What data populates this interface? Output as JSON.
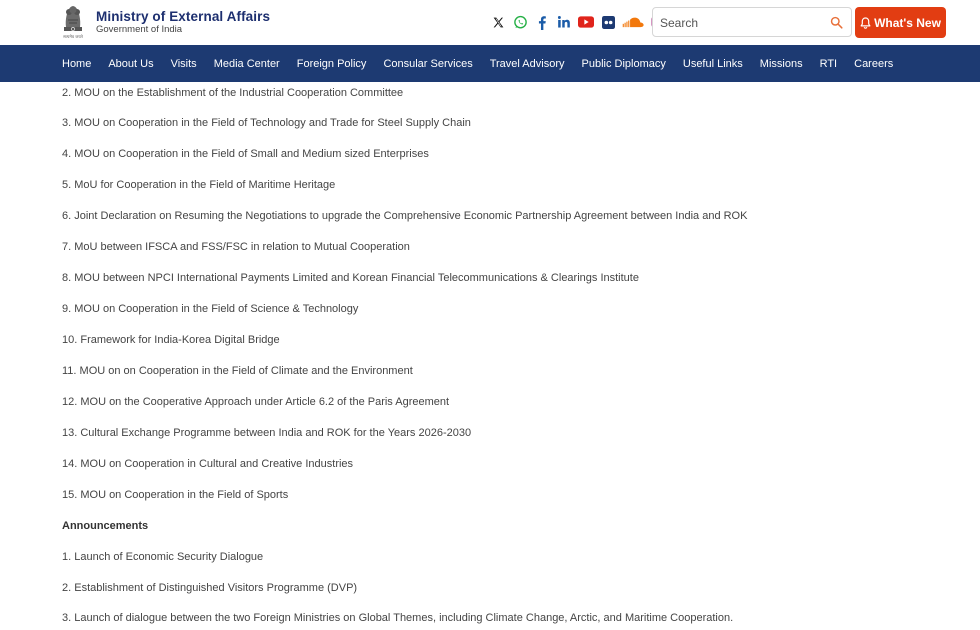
{
  "header": {
    "title": "Ministry of External Affairs",
    "subtitle": "Government of India",
    "emblem_caption": "सत्यमेव जयते"
  },
  "socials": [
    {
      "name": "x-icon"
    },
    {
      "name": "whatsapp-icon"
    },
    {
      "name": "facebook-icon"
    },
    {
      "name": "linkedin-icon"
    },
    {
      "name": "youtube-icon"
    },
    {
      "name": "flickr-icon"
    },
    {
      "name": "soundcloud-icon"
    },
    {
      "name": "instagram-icon"
    }
  ],
  "search": {
    "placeholder": "Search"
  },
  "whats_new": {
    "label": "What's New"
  },
  "nav": {
    "items": [
      "Home",
      "About Us",
      "Visits",
      "Media Center",
      "Foreign Policy",
      "Consular Services",
      "Travel Advisory",
      "Public Diplomacy",
      "Useful Links",
      "Missions",
      "RTI",
      "Careers"
    ]
  },
  "content": {
    "mous": [
      "2. MOU on the Establishment of the Industrial Cooperation Committee",
      "3. MOU on Cooperation in the Field of Technology and Trade for Steel Supply Chain",
      "4. MOU on Cooperation in the Field of Small and Medium sized Enterprises",
      "5. MoU for Cooperation in the Field of Maritime Heritage",
      "6. Joint Declaration on Resuming the Negotiations to upgrade the Comprehensive Economic Partnership Agreement between India and ROK",
      "7. MoU between IFSCA and FSS/FSC in relation to Mutual Cooperation",
      "8. MOU between NPCI International Payments Limited and Korean Financial Telecommunications & Clearings Institute",
      "9. MOU on Cooperation in the Field of Science & Technology",
      "10. Framework for India-Korea Digital Bridge",
      "11. MOU on on Cooperation in the Field of Climate and the Environment",
      "12. MOU on the Cooperative Approach under Article 6.2 of the Paris Agreement",
      "13. Cultural Exchange Programme between India and ROK for the Years 2026-2030",
      "14. MOU on Cooperation in Cultural and Creative Industries",
      "15. MOU on Cooperation in the Field of Sports"
    ],
    "announcements_heading": "Announcements",
    "announcements": [
      "1. Launch of Economic Security Dialogue",
      "2. Establishment of Distinguished Visitors Programme (DVP)",
      "3. Launch of dialogue between the two Foreign Ministries on Global Themes, including Climate Change, Arctic, and Maritime Cooperation."
    ]
  },
  "colors": {
    "brand_navy": "#1d2f6f",
    "nav_bg": "#1d3a72",
    "whats_new_bg": "#e23d12",
    "search_icon": "#e8703a"
  }
}
